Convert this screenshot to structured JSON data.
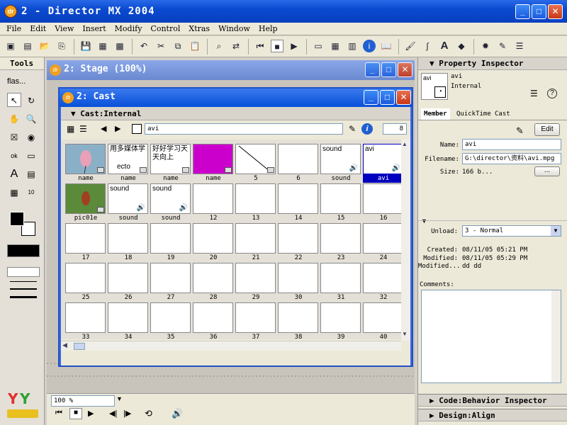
{
  "window": {
    "title": "2 - Director MX 2004",
    "icon": "dr"
  },
  "menu": [
    "File",
    "Edit",
    "View",
    "Insert",
    "Modify",
    "Control",
    "Xtras",
    "Window",
    "Help"
  ],
  "tools_panel": {
    "title": "Tools",
    "dropdown": "flas..."
  },
  "stage": {
    "title": "2: Stage (100%)",
    "zoom": "100 %"
  },
  "cast_window": {
    "title": "2: Cast",
    "header": "Cast:Internal",
    "member_name": "avi",
    "member_number": "8",
    "cells": [
      {
        "thumb": "image-bird",
        "text": "",
        "label": "name"
      },
      {
        "thumb": "text",
        "text": "用多媒体学",
        "text2": "ecto",
        "label": "name"
      },
      {
        "thumb": "text",
        "text": "好好学习天天向上",
        "label": "name"
      },
      {
        "thumb": "color",
        "text": "",
        "label": "name",
        "color": "#cc00cc"
      },
      {
        "thumb": "line",
        "text": "",
        "label": "5"
      },
      {
        "thumb": "blank",
        "text": "",
        "label": "6"
      },
      {
        "thumb": "sound",
        "text": "sound",
        "label": "sound"
      },
      {
        "thumb": "sound",
        "text": "avi",
        "label": "avi",
        "selected": true
      },
      {
        "thumb": "image-grass",
        "text": "",
        "label": "pic01e"
      },
      {
        "thumb": "sound",
        "text": "sound",
        "label": "sound"
      },
      {
        "thumb": "sound",
        "text": "sound",
        "label": "sound"
      },
      {
        "thumb": "blank",
        "text": "",
        "label": "12"
      },
      {
        "thumb": "blank",
        "text": "",
        "label": "13"
      },
      {
        "thumb": "blank",
        "text": "",
        "label": "14"
      },
      {
        "thumb": "blank",
        "text": "",
        "label": "15"
      },
      {
        "thumb": "blank",
        "text": "",
        "label": "16"
      },
      {
        "thumb": "blank",
        "text": "",
        "label": "17"
      },
      {
        "thumb": "blank",
        "text": "",
        "label": "18"
      },
      {
        "thumb": "blank",
        "text": "",
        "label": "19"
      },
      {
        "thumb": "blank",
        "text": "",
        "label": "20"
      },
      {
        "thumb": "blank",
        "text": "",
        "label": "21"
      },
      {
        "thumb": "blank",
        "text": "",
        "label": "22"
      },
      {
        "thumb": "blank",
        "text": "",
        "label": "23"
      },
      {
        "thumb": "blank",
        "text": "",
        "label": "24"
      },
      {
        "thumb": "blank",
        "text": "",
        "label": "25"
      },
      {
        "thumb": "blank",
        "text": "",
        "label": "26"
      },
      {
        "thumb": "blank",
        "text": "",
        "label": "27"
      },
      {
        "thumb": "blank",
        "text": "",
        "label": "28"
      },
      {
        "thumb": "blank",
        "text": "",
        "label": "29"
      },
      {
        "thumb": "blank",
        "text": "",
        "label": "30"
      },
      {
        "thumb": "blank",
        "text": "",
        "label": "31"
      },
      {
        "thumb": "blank",
        "text": "",
        "label": "32"
      },
      {
        "thumb": "blank",
        "text": "",
        "label": "33"
      },
      {
        "thumb": "blank",
        "text": "",
        "label": "34"
      },
      {
        "thumb": "blank",
        "text": "",
        "label": "35"
      },
      {
        "thumb": "blank",
        "text": "",
        "label": "36"
      },
      {
        "thumb": "blank",
        "text": "",
        "label": "37"
      },
      {
        "thumb": "blank",
        "text": "",
        "label": "38"
      },
      {
        "thumb": "blank",
        "text": "",
        "label": "39"
      },
      {
        "thumb": "blank",
        "text": "",
        "label": "40"
      }
    ]
  },
  "property_inspector": {
    "title": "Property Inspector",
    "member_name": "avi",
    "member_cast": "Internal",
    "tabs": [
      "Member",
      "QuickTime",
      "Cast"
    ],
    "edit_button": "Edit",
    "name_label": "Name:",
    "name_value": "avi",
    "filename_label": "Filename:",
    "filename_value": "G:\\director\\资料\\avi.mpg",
    "size_label": "Size:",
    "size_value": "166 b...",
    "browse_button": "...",
    "unload_label": "Unload:",
    "unload_value": "3 - Normal",
    "created_label": "Created:",
    "created_value": "08/11/05 05:21 PM",
    "modified_label": "Modified:",
    "modified_value": "08/11/05 05:29 PM",
    "modifiedby_label": "Modified...",
    "modifiedby_value": "dd dd",
    "comments_label": "Comments:",
    "panel2": "Code:Behavior Inspector",
    "panel3": "Design:Align"
  }
}
